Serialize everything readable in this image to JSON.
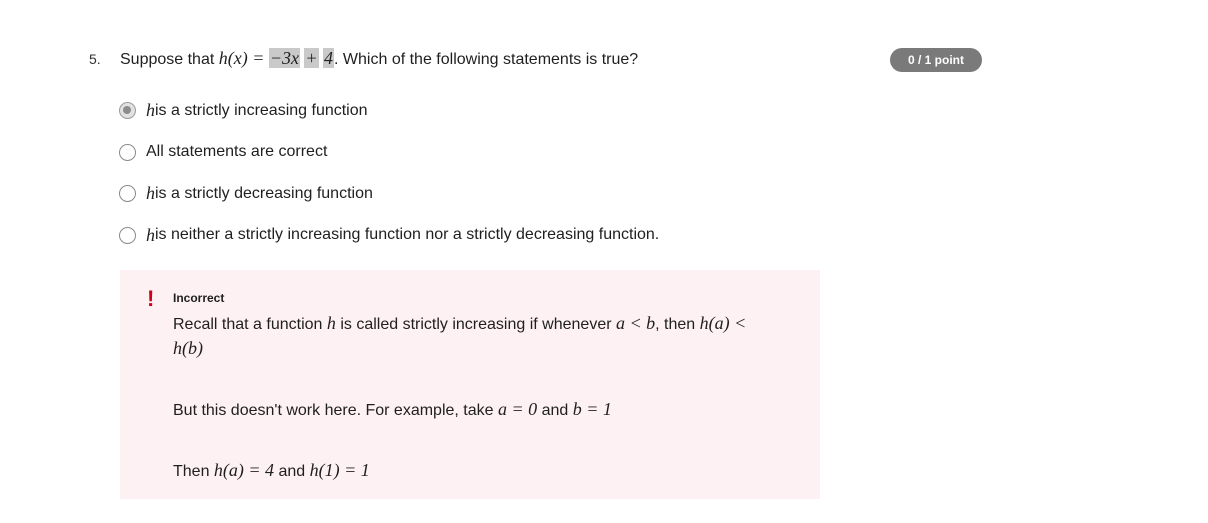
{
  "question": {
    "number": "5.",
    "prefix": "Suppose that ",
    "func": "h(x) =",
    "rhs_part1": "−3x",
    "rhs_plus": "+",
    "rhs_part2": "4",
    "suffix": ". Which of the following statements is true?"
  },
  "score": {
    "label": "0 / 1 point"
  },
  "options": [
    {
      "var": "h",
      "text": " is a strictly increasing function",
      "selected": true
    },
    {
      "var": "",
      "text": "All statements are correct",
      "selected": false
    },
    {
      "var": "h",
      "text": " is a strictly decreasing function",
      "selected": false
    },
    {
      "var": "h",
      "text": " is neither a strictly increasing function nor a strictly decreasing function.",
      "selected": false
    }
  ],
  "feedback": {
    "icon": "!",
    "status": "Incorrect",
    "line1_a": "Recall that a function ",
    "line1_var": "h",
    "line1_b": " is called strictly increasing if whenever ",
    "line1_math": "a < b",
    "line1_c": ", then ",
    "line1_math2": "h(a) <",
    "line2_math": "h(b)",
    "line3_a": "But this doesn't work here. For example, take ",
    "line3_math1": "a = 0",
    "line3_b": " and ",
    "line3_math2": "b = 1",
    "line4_a": "Then ",
    "line4_math1": "h(a) = 4",
    "line4_b": " and ",
    "line4_math2": "h(1) = 1"
  },
  "colors": {
    "badge": "#7a7a7a",
    "feedback_bg": "#fdf1f3",
    "alert": "#d0021b"
  }
}
